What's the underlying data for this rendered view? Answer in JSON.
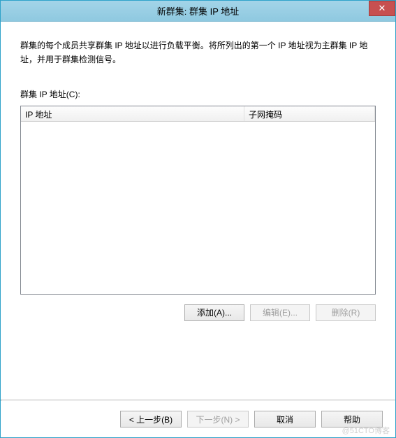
{
  "titlebar": {
    "title": "新群集: 群集 IP 地址",
    "close_icon": "✕"
  },
  "description": "群集的每个成员共享群集 IP 地址以进行负载平衡。将所列出的第一个 IP 地址视为主群集 IP 地址，并用于群集检测信号。",
  "list": {
    "label": "群集 IP 地址(C):",
    "columns": {
      "ip": "IP 地址",
      "mask": "子网掩码"
    }
  },
  "actions": {
    "add": "添加(A)...",
    "edit": "编辑(E)...",
    "remove": "删除(R)"
  },
  "footer": {
    "back": "< 上一步(B)",
    "next": "下一步(N) >",
    "cancel": "取消",
    "help": "帮助"
  },
  "watermark": "@51CTO博客"
}
